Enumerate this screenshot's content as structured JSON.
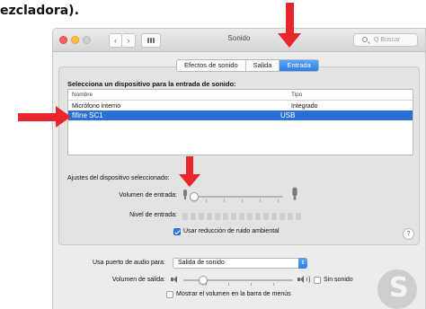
{
  "caption_fragment": "ezcladora).",
  "window": {
    "title": "Sonido",
    "search_placeholder": "Q Buscar",
    "nav_back": "‹",
    "nav_forward": "›",
    "grid_icon": "grid-icon"
  },
  "tabs": [
    {
      "label": "Efectos de sonido",
      "active": false
    },
    {
      "label": "Salida",
      "active": false
    },
    {
      "label": "Entrada",
      "active": true
    }
  ],
  "input": {
    "heading": "Selecciona un dispositivo para la entrada de sonido:",
    "columns": [
      "Nombre",
      "Tipo"
    ],
    "devices": [
      {
        "name": "Micrófono interno",
        "type": "Integrado",
        "selected": false
      },
      {
        "name": "fifine SC1",
        "type": "USB",
        "selected": true
      }
    ],
    "settings_label": "Ajustes del dispositivo seleccionado:",
    "volume_label": "Volumen de entrada:",
    "volume_level": 0.05,
    "level_label": "Nivel de entrada:",
    "noise_reduction_label": "Usar reducción de ruido ambiental",
    "noise_reduction_checked": true,
    "help_label": "?"
  },
  "output": {
    "audio_port_label": "Usa puerto de audio para:",
    "audio_port_value": "Salida de sonido",
    "volume_label": "Volumen de salida:",
    "volume_level": 0.18,
    "mute_label": "Sin sonido",
    "mute_checked": false,
    "menu_bar_label": "Mostrar el volumen en la barra de menús",
    "menu_bar_checked": false
  },
  "annotation_color": "#e8262b",
  "watermark_letter": "S"
}
